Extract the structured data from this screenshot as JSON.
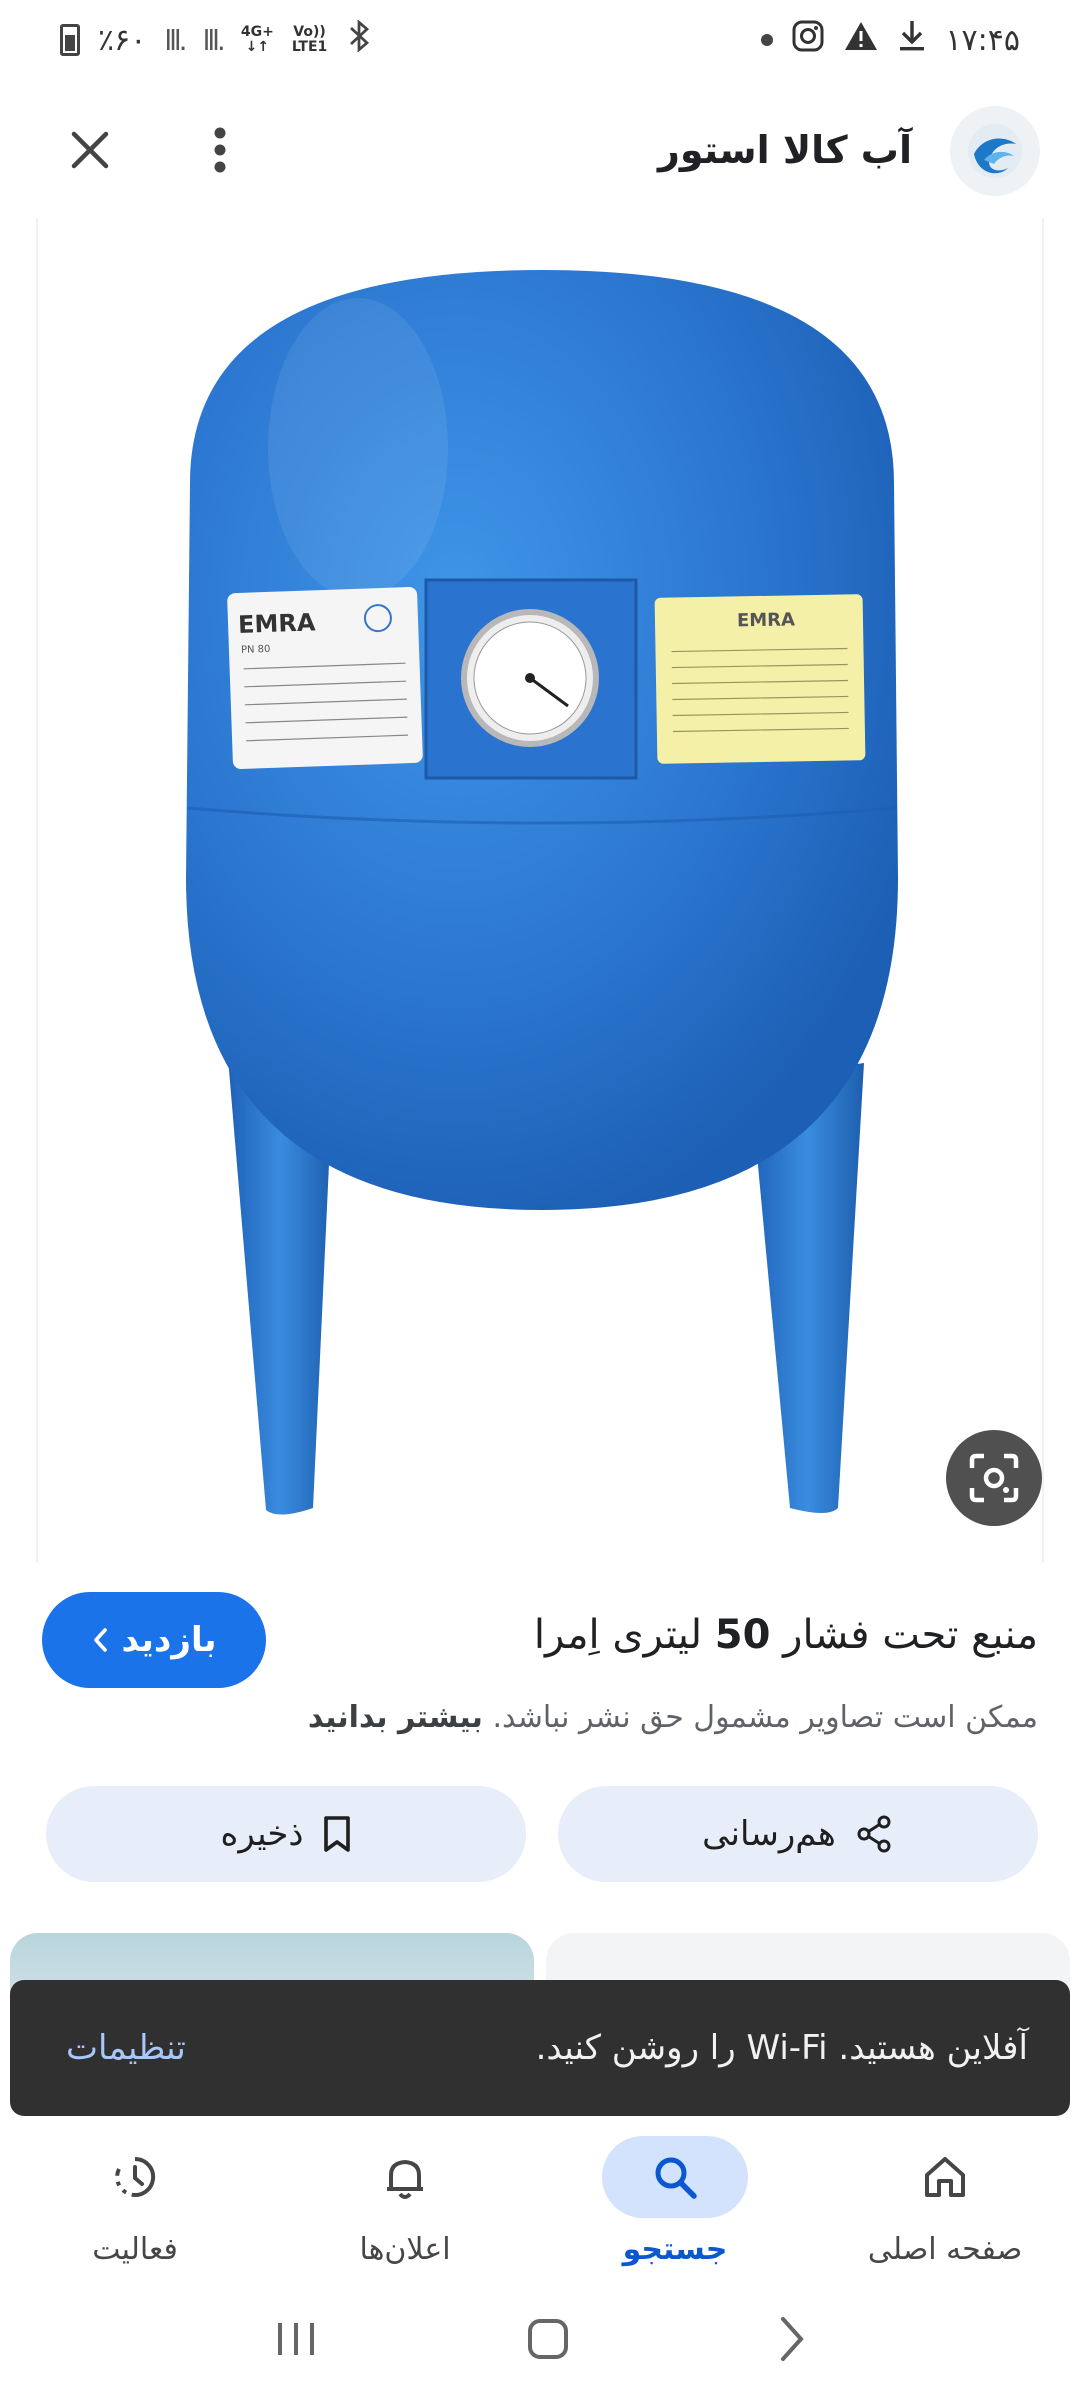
{
  "status_bar": {
    "time": "۱۷:۴۵",
    "battery": "٪۶۰",
    "signal_glyph": "lll.",
    "net_top": "4G+",
    "net_bottom": "↓↑",
    "volte_top": "Vo))",
    "volte_bottom": "LTE1"
  },
  "header": {
    "site_title": "آب کالا استور"
  },
  "product": {
    "badge_brand": "EMRA",
    "badge_pn": "PN  80"
  },
  "info": {
    "title_prefix": "منبع تحت فشار ",
    "title_number": "50",
    "title_suffix": " لیتری اِمرا",
    "visit_label": "بازدید",
    "copyright_text": "ممکن است تصاویر مشمول حق نشر نباشد. ",
    "learn_more": "بیشتر بدانید",
    "share_label": "هم‌رسانی",
    "save_label": "ذخیره"
  },
  "snackbar": {
    "message": "آفلاین هستید. Wi-Fi را روشن کنید.",
    "action": "تنظیمات"
  },
  "bottom_nav": {
    "items": [
      {
        "label": "صفحه اصلی",
        "icon": "home-icon"
      },
      {
        "label": "جستجو",
        "icon": "search-icon",
        "active": true
      },
      {
        "label": "اعلان‌ها",
        "icon": "bell-icon"
      },
      {
        "label": "فعالیت",
        "icon": "activity-icon"
      }
    ]
  },
  "colors": {
    "accent": "#1a73e8",
    "tank_blue": "#2f7fd6",
    "nav_active": "#d3e3fd",
    "pill_bg": "#e8eef9",
    "snackbar_bg": "#303030"
  }
}
